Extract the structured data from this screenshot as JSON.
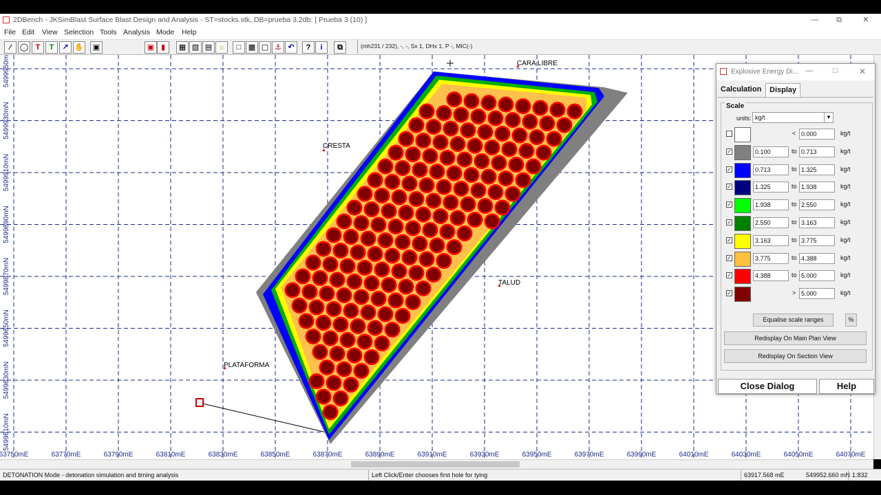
{
  "window": {
    "title": "2DBench - JKSimBlast Surface Blast Design and Analysis - ST=stocks.stk, DB=prueba 3.2db: [ Prueba 3 (10) ]"
  },
  "menu": [
    "File",
    "Edit",
    "View",
    "Selection",
    "Tools",
    "Analysis",
    "Mode",
    "Help"
  ],
  "toolbar": {
    "status_text": "(mh231 / 232), -, -, Sx 1, DHx 1, P -, MIC(-)"
  },
  "plot": {
    "y_labels": [
      "5499950mN",
      "5499930mN",
      "5499910mN",
      "5499890mN",
      "5499870mN",
      "5499850mN",
      "5499830mN",
      "5499810mN"
    ],
    "x_labels": [
      "63750mE",
      "63770mE",
      "63790mE",
      "63810mE",
      "63830mE",
      "63850mE",
      "63870mE",
      "63890mE",
      "63910mE",
      "63930mE",
      "63950mE",
      "63970mE",
      "63990mE",
      "64010mE",
      "64030mE",
      "64050mE",
      "64070mE"
    ],
    "annotations": {
      "cara_libre": "CARA LIBRE",
      "cresta": "CRESTA",
      "talud": "TALUD",
      "plataforma": "PLATAFORMA"
    },
    "colors": {
      "gray": "#808080",
      "blue": "#0000ff",
      "green": "#00c000",
      "yellow": "#ffff00",
      "orange": "#ffc04c",
      "red": "#ff0000",
      "dark_red": "#800000"
    }
  },
  "status": {
    "mode": "DETONATION Mode - detonation simulation and timing analysis",
    "hint": "Left Click/Enter chooses first hole for tying",
    "easting": "63917.568 mE",
    "northing": "549952.660 mN",
    "scale": "1:832"
  },
  "dialog": {
    "title": "Explosive Energy Di...",
    "tabs": [
      "Calculation",
      "Display"
    ],
    "active_tab": "Display",
    "scale_label": "Scale",
    "units_label": "units:",
    "units_value": "kg/t",
    "unit_suffix": "kg/t",
    "to_word": "to",
    "rows": [
      {
        "checked": false,
        "color": "#ffffff",
        "from": "",
        "op": "<",
        "to": "0.000"
      },
      {
        "checked": true,
        "color": "#808080",
        "from": "0.100",
        "op": "to",
        "to": "0.713"
      },
      {
        "checked": true,
        "color": "#0000ff",
        "from": "0.713",
        "op": "to",
        "to": "1.325"
      },
      {
        "checked": true,
        "color": "#000080",
        "from": "1.325",
        "op": "to",
        "to": "1.938"
      },
      {
        "checked": true,
        "color": "#00ff00",
        "from": "1.938",
        "op": "to",
        "to": "2.550"
      },
      {
        "checked": true,
        "color": "#008000",
        "from": "2.550",
        "op": "to",
        "to": "3.163"
      },
      {
        "checked": true,
        "color": "#ffff00",
        "from": "3.163",
        "op": "to",
        "to": "3.775"
      },
      {
        "checked": true,
        "color": "#ffc040",
        "from": "3.775",
        "op": "to",
        "to": "4.388"
      },
      {
        "checked": true,
        "color": "#ff0000",
        "from": "4.388",
        "op": "to",
        "to": "5.000"
      },
      {
        "checked": true,
        "color": "#800000",
        "from": "",
        "op": ">",
        "to": "5.000"
      }
    ],
    "equalise_label": "Equalise scale ranges",
    "percent_label": "%",
    "redisplay_main": "Redisplay On Main Plan View",
    "redisplay_section": "Redisplay On Section View",
    "close_label": "Close Dialog",
    "help_label": "Help"
  }
}
